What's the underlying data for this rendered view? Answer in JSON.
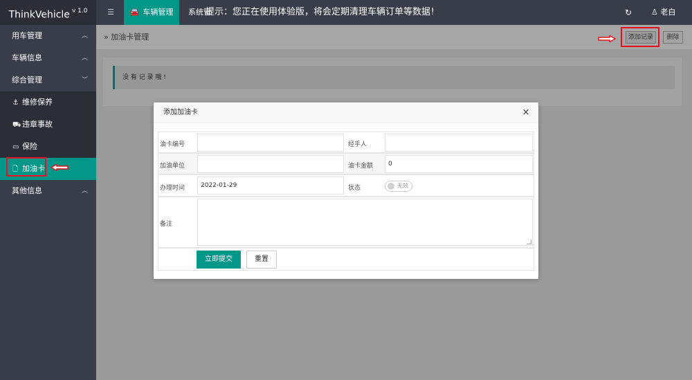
{
  "app": {
    "name": "ThinkVehicle",
    "version": "v 1.0"
  },
  "topnav": {
    "menu_toggle_icon": "menu-icon",
    "active_tab": "车辆管理",
    "second_tab": "系统管",
    "notice": "提示：您正在使用体验版，将会定期清理车辆订单等数据！",
    "user": "老白",
    "accent_color": "#009688"
  },
  "sidebar": {
    "groups": [
      {
        "label": "用车管理",
        "chevron": "^"
      },
      {
        "label": "车辆信息",
        "chevron": "^"
      },
      {
        "label": "综合管理",
        "chevron": "v"
      }
    ],
    "subitems": [
      {
        "label": "维修保养",
        "icon": "anchor-icon"
      },
      {
        "label": "违章事故",
        "icon": "truck-icon"
      },
      {
        "label": "保险",
        "icon": "card-icon"
      },
      {
        "label": "加油卡",
        "icon": "file-icon"
      }
    ],
    "last_group": {
      "label": "其他信息",
      "chevron": "^"
    }
  },
  "breadcrumb": {
    "prefix": "»",
    "title": "加油卡管理"
  },
  "toolbar": {
    "add_label": "添加记录",
    "delete_label": "删除"
  },
  "content": {
    "empty_message": "没 有 记 录 哦 !"
  },
  "modal": {
    "title": "添加加油卡",
    "close": "×",
    "fields": {
      "card_number_label": "油卡编号",
      "card_number_value": "",
      "handler_label": "经手人",
      "handler_value": "",
      "unit_label": "加油单位",
      "unit_value": "",
      "amount_label": "油卡金额",
      "amount_value": "0",
      "date_label": "办理时间",
      "date_value": "2022-01-29",
      "status_label": "状态",
      "status_value": "无效",
      "remark_label": "备注",
      "remark_value": ""
    },
    "submit_label": "立即提交",
    "reset_label": "重置"
  }
}
